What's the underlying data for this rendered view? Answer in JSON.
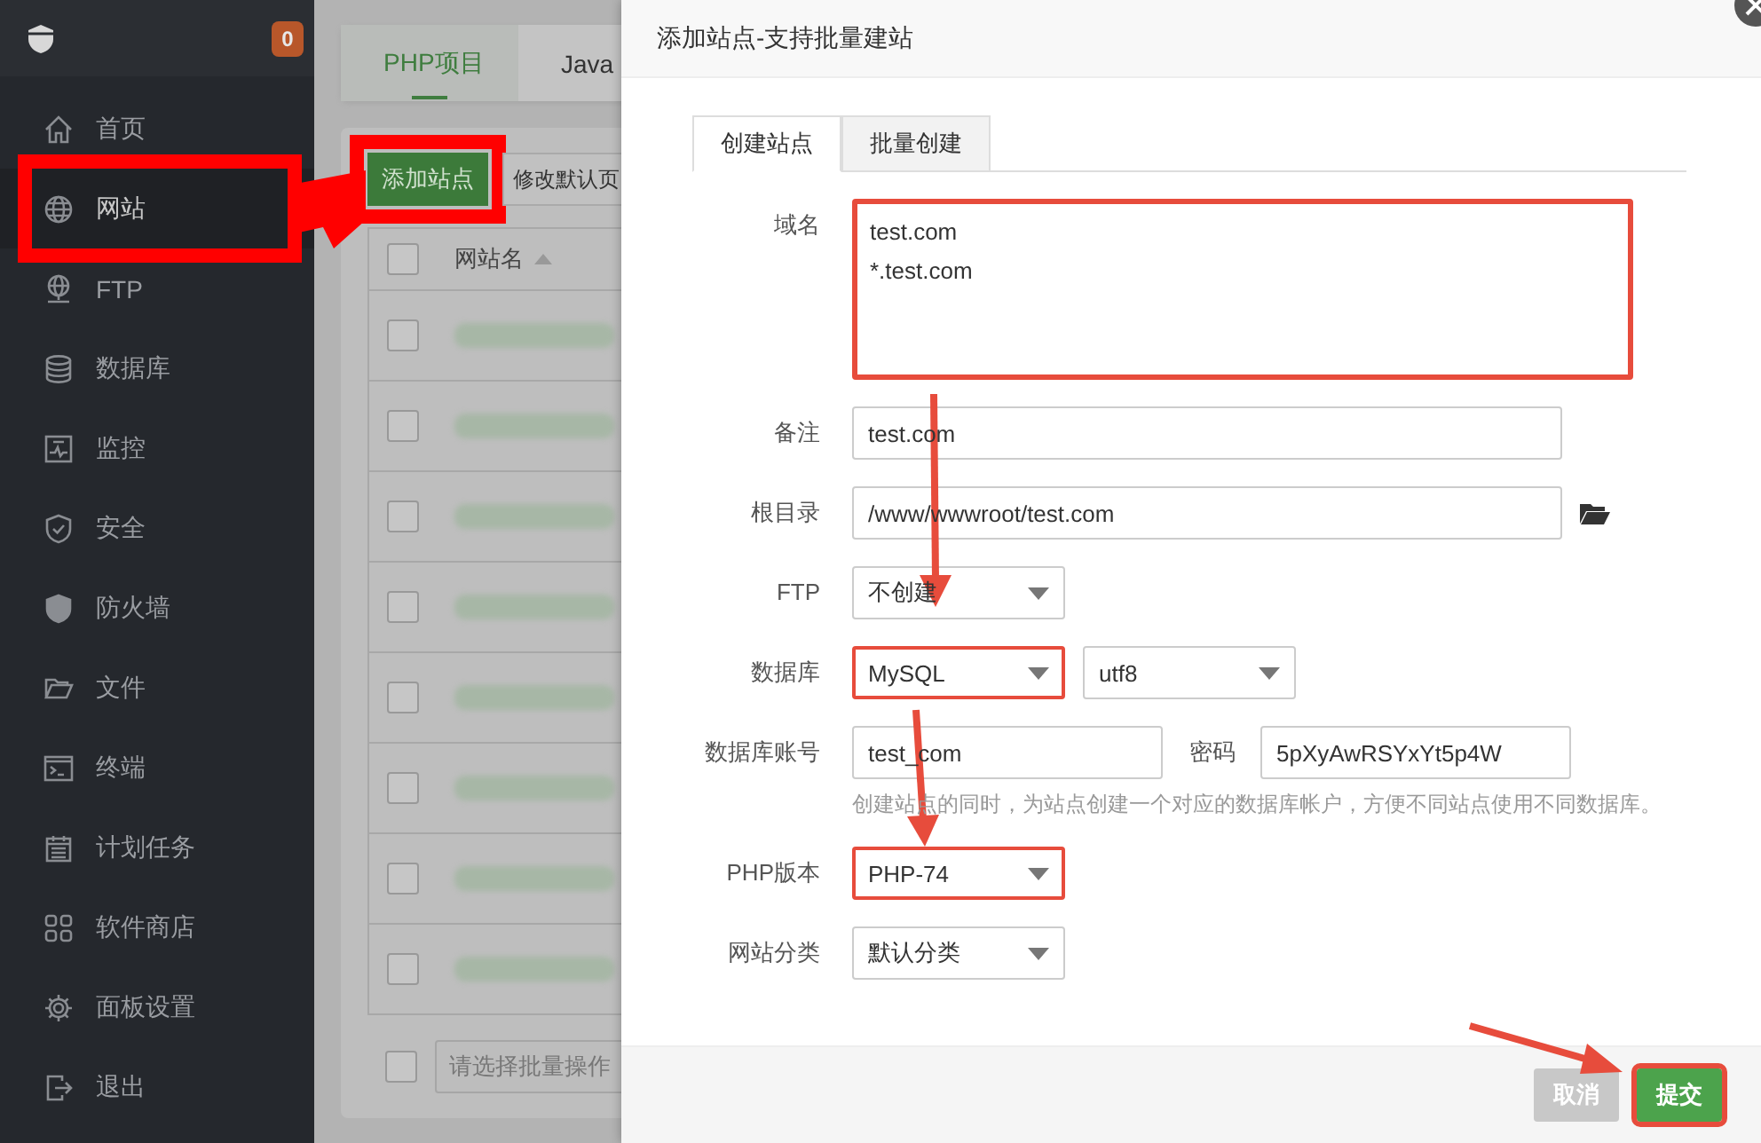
{
  "sidebar": {
    "badge": "0",
    "items": [
      {
        "label": "首页",
        "selected": false,
        "highlighted": false
      },
      {
        "label": "网站",
        "selected": true,
        "highlighted": true
      },
      {
        "label": "FTP",
        "selected": false,
        "highlighted": false
      },
      {
        "label": "数据库",
        "selected": false,
        "highlighted": false
      },
      {
        "label": "监控",
        "selected": false,
        "highlighted": false
      },
      {
        "label": "安全",
        "selected": false,
        "highlighted": false
      },
      {
        "label": "防火墙",
        "selected": false,
        "highlighted": false
      },
      {
        "label": "文件",
        "selected": false,
        "highlighted": false
      },
      {
        "label": "终端",
        "selected": false,
        "highlighted": false
      },
      {
        "label": "计划任务",
        "selected": false,
        "highlighted": false
      },
      {
        "label": "软件商店",
        "selected": false,
        "highlighted": false
      },
      {
        "label": "面板设置",
        "selected": false,
        "highlighted": false
      },
      {
        "label": "退出",
        "selected": false,
        "highlighted": false
      }
    ]
  },
  "main": {
    "tabs": [
      {
        "label": "PHP项目",
        "selected": true
      },
      {
        "label": "Java",
        "selected": false
      }
    ],
    "toolbar": [
      {
        "label": "添加站点",
        "kind": "primary",
        "highlighted": true
      },
      {
        "label": "修改默认页",
        "kind": "default",
        "highlighted": false
      }
    ],
    "table": {
      "columns": [
        {
          "label": "网站名",
          "sorted": true
        }
      ],
      "header_checked": false,
      "rows": [
        {
          "checked": false
        },
        {
          "checked": false
        },
        {
          "checked": false
        },
        {
          "checked": false
        },
        {
          "checked": false
        },
        {
          "checked": false
        },
        {
          "checked": false
        },
        {
          "checked": false
        }
      ]
    },
    "footer": {
      "checked": false,
      "batch_select": {
        "placeholder": "请选择批量操作"
      }
    }
  },
  "dialog": {
    "title": "添加站点-支持批量建站",
    "tabs": [
      {
        "label": "创建站点",
        "selected": true
      },
      {
        "label": "批量创建",
        "selected": false
      }
    ],
    "fields": [
      {
        "label": "域名",
        "kind": "textarea",
        "value": "test.com\n*.test.com",
        "highlighted": true
      },
      {
        "label": "备注",
        "kind": "text",
        "value": "test.com",
        "highlighted": false
      },
      {
        "label": "根目录",
        "kind": "path",
        "value": "/www/wwwroot/test.com",
        "highlighted": false
      },
      {
        "label": "FTP",
        "kind": "select",
        "value": "不创建",
        "highlighted": false
      },
      {
        "label": "数据库",
        "kind": "select",
        "value": "MySQL",
        "highlighted": true,
        "extra": {
          "value": "utf8"
        }
      },
      {
        "label": "数据库账号",
        "kind": "short",
        "value": "test_com",
        "highlighted": false,
        "pair": {
          "label": "密码",
          "value": "5pXyAwRSYxYt5p4W"
        },
        "hint": "创建站点的同时，为站点创建一个对应的数据库帐户，方便不同站点使用不同数据库。"
      },
      {
        "label": "PHP版本",
        "kind": "select",
        "value": "PHP-74",
        "highlighted": true
      },
      {
        "label": "网站分类",
        "kind": "select",
        "value": "默认分类",
        "highlighted": false
      }
    ],
    "buttons": [
      {
        "label": "取消",
        "kind": "cancel",
        "highlighted": false
      },
      {
        "label": "提交",
        "kind": "submit",
        "highlighted": true
      }
    ]
  }
}
